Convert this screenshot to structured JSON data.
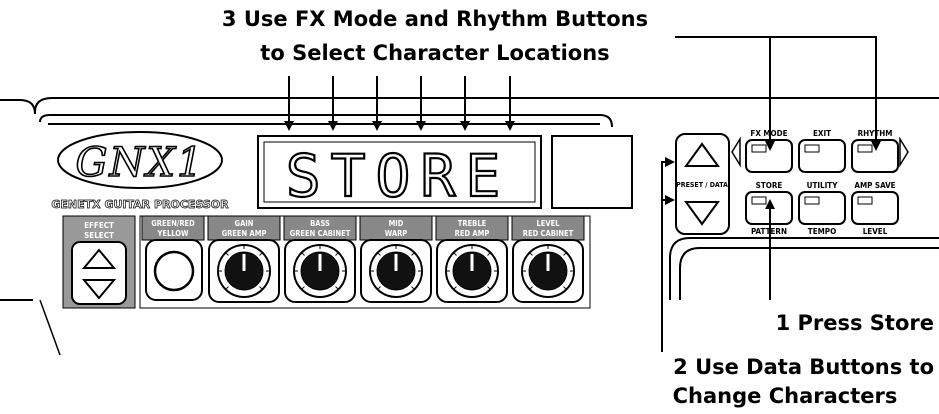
{
  "callouts": {
    "step3_line1": "3 Use FX Mode and Rhythm Buttons",
    "step3_line2": "to Select Character Locations",
    "step1": "1 Press Store",
    "step2_line1": "2 Use Data Buttons to",
    "step2_line2": "Change Characters"
  },
  "device": {
    "logo": "GNX1",
    "brand_line": "GENETX GUITAR PROCESSOR",
    "display_text": "STORE",
    "effect_select": [
      "EFFECT",
      "SELECT"
    ],
    "knobs": [
      {
        "top": "GAIN",
        "bottom": "GREEN AMP"
      },
      {
        "top": "BASS",
        "bottom": "GREEN CABINET"
      },
      {
        "top": "MID",
        "bottom": "WARP"
      },
      {
        "top": "TREBLE",
        "bottom": "RED AMP"
      },
      {
        "top": "LEVEL",
        "bottom": "RED CABINET"
      }
    ],
    "select_button": {
      "top": "GREEN/RED",
      "bottom": "YELLOW"
    },
    "preset_data": "PRESET / DATA",
    "buttons": [
      {
        "top": "FX MODE",
        "bottom": ""
      },
      {
        "top": "EXIT",
        "bottom": ""
      },
      {
        "top": "RHYTHM",
        "bottom": ""
      },
      {
        "top": "STORE",
        "bottom": "PATTERN"
      },
      {
        "top": "UTILITY",
        "bottom": "TEMPO"
      },
      {
        "top": "AMP SAVE",
        "bottom": "LEVEL"
      }
    ]
  },
  "colors": {
    "ink": "#000000",
    "panel": "#ffffff",
    "strip": "#888888"
  }
}
